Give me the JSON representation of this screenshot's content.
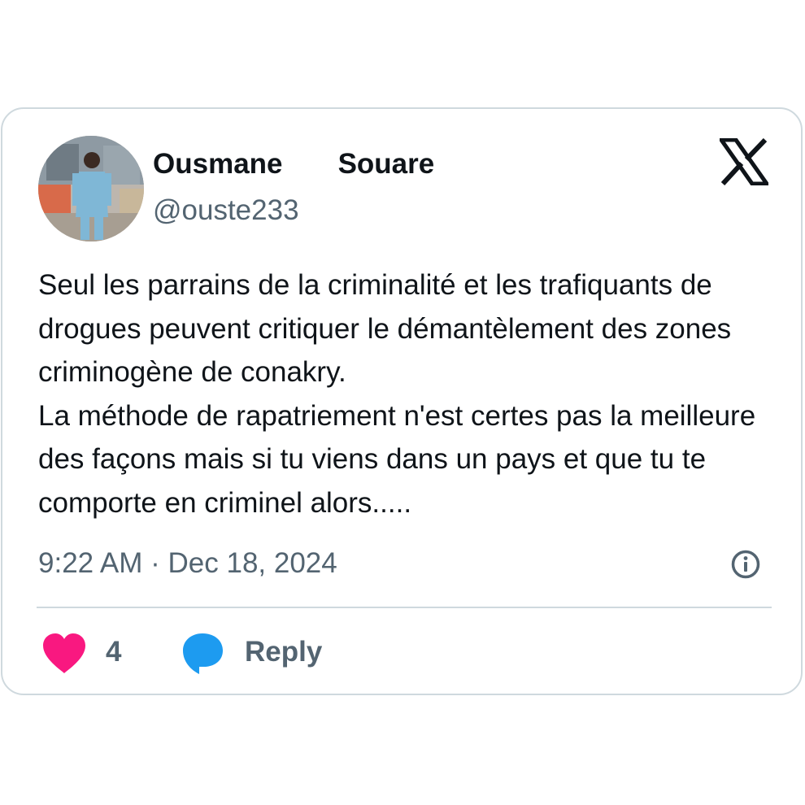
{
  "tweet": {
    "author": {
      "display_name": "Ousmane       Souare",
      "handle": "@ouste233",
      "avatar": "profile-photo"
    },
    "platform_logo": "x-logo-icon",
    "text": "Seul les parrains de la criminalité et les trafiquants de drogues peuvent critiquer le démantèlement des zones criminogène de conakry.\nLa méthode de rapatriement n'est certes pas la meilleure des façons mais si tu viens dans un pays et que tu te comporte en criminel alors.....",
    "timestamp": "9:22 AM · Dec 18, 2024",
    "info_icon": "info-icon",
    "actions": {
      "like_icon": "heart-icon",
      "like_count": "4",
      "reply_icon": "speech-bubble-icon",
      "reply_label": "Reply"
    }
  },
  "colors": {
    "text_primary": "#0f1419",
    "text_secondary": "#536471",
    "border": "#cfd9de",
    "like": "#f91880",
    "reply": "#1d9bf0"
  }
}
